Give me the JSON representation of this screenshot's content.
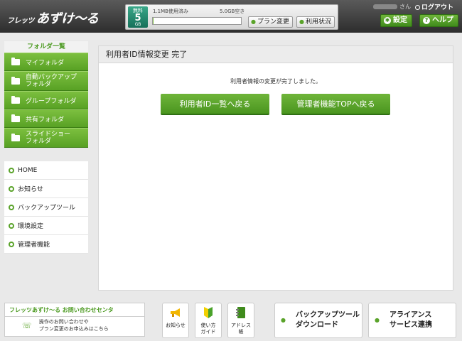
{
  "header": {
    "logo_small": "フレッツ",
    "logo_main": "あずけ〜る",
    "plan": {
      "line1": "無料",
      "line2": "5",
      "line3": "GB"
    },
    "used_label": "1.1MB使用済み",
    "free_label": "5.0GB空き",
    "usage_fraction": 0.0002,
    "plan_change_label": "プラン変更",
    "usage_status_label": "利用状況",
    "user_suffix": "さん",
    "logout_label": "ログアウト",
    "settings_label": "設定",
    "help_label": "ヘルプ"
  },
  "sidebar": {
    "folder_title": "フォルダ一覧",
    "folders": [
      {
        "label": "マイフォルダ"
      },
      {
        "label": "自動バックアップ\nフォルダ"
      },
      {
        "label": "グループフォルダ"
      },
      {
        "label": "共有フォルダ"
      },
      {
        "label": "スライドショー\nフォルダ"
      }
    ],
    "nav": [
      {
        "label": "HOME"
      },
      {
        "label": "お知らせ"
      },
      {
        "label": "バックアップツール"
      },
      {
        "label": "環境設定"
      },
      {
        "label": "管理者機能"
      }
    ]
  },
  "main": {
    "title": "利用者ID情報変更 完了",
    "message": "利用者情報の変更が完了しました。",
    "button_user_list": "利用者ID一覧へ戻る",
    "button_admin_top": "管理者機能TOPへ戻る"
  },
  "footer": {
    "contact_title": "フレッツあずけ〜る お問い合わせセンタ",
    "contact_line1": "操作のお問い合わせや",
    "contact_line2": "プラン変更のお申込みはこちら",
    "tile_news": "お知らせ",
    "tile_guide_1": "使い方",
    "tile_guide_2": "ガイド",
    "tile_address_1": "アドレス",
    "tile_address_2": "帳",
    "backup_tool_1": "バックアップツール",
    "backup_tool_2": "ダウンロード",
    "alliance_1": "アライアンス",
    "alliance_2": "サービス連携"
  }
}
